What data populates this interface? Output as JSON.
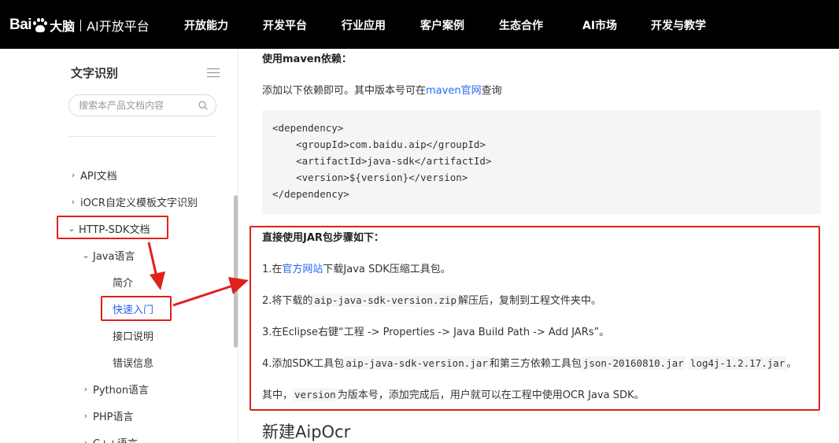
{
  "header": {
    "logo_bai": "Bai",
    "logo_brand": "大脑",
    "logo_product": "AI开放平台",
    "nav": [
      "开放能力",
      "开发平台",
      "行业应用",
      "客户案例",
      "生态合作",
      "AI市场",
      "开发与教学"
    ]
  },
  "sidebar": {
    "title": "文字识别",
    "search_placeholder": "搜索本产品文档内容",
    "items": [
      {
        "label": "API文档",
        "chevron": "›"
      },
      {
        "label": "iOCR自定义模板文字识别",
        "chevron": "›"
      },
      {
        "label": "HTTP-SDK文档",
        "chevron": "⌄"
      },
      {
        "label": "Java语言",
        "chevron": "⌄"
      },
      {
        "label": "简介"
      },
      {
        "label": "快速入门"
      },
      {
        "label": "接口说明"
      },
      {
        "label": "错误信息"
      },
      {
        "label": "Python语言",
        "chevron": "›"
      },
      {
        "label": "PHP语言",
        "chevron": "›"
      },
      {
        "label": "C++语言",
        "chevron": "›"
      }
    ]
  },
  "content": {
    "maven_heading": "使用maven依赖：",
    "maven_text_before": "添加以下依赖即可。其中版本号可在",
    "maven_link": "maven官网",
    "maven_text_after": "查询",
    "code_lines": [
      "<dependency>",
      "    <groupId>com.baidu.aip</groupId>",
      "    <artifactId>java-sdk</artifactId>",
      "    <version>${version}</version>",
      "</dependency>"
    ],
    "jar_heading": "直接使用JAR包步骤如下：",
    "step1_before": "1.在",
    "step1_link": "官方网站",
    "step1_after": "下载Java SDK压缩工具包。",
    "step2_before": "2.将下载的",
    "step2_code": "aip-java-sdk-version.zip",
    "step2_after": "解压后，复制到工程文件夹中。",
    "step3": "3.在Eclipse右键“工程 -> Properties -> Java Build Path -> Add JARs”。",
    "step4_before": "4.添加SDK工具包",
    "step4_code1": "aip-java-sdk-version.jar",
    "step4_mid": "和第三方依赖工具包",
    "step4_code2": "json-20160810.jar",
    "step4_code3": "log4j-1.2.17.jar",
    "step4_after": "。",
    "note_before": "其中，",
    "note_code": "version",
    "note_after": "为版本号，添加完成后，用户就可以在工程中使用OCR Java SDK。",
    "next_section": "新建AipOcr"
  },
  "colors": {
    "topbar": "#000000",
    "link": "#2468f2",
    "annotation": "#e0201b",
    "code_bg": "#f6f5f3"
  }
}
